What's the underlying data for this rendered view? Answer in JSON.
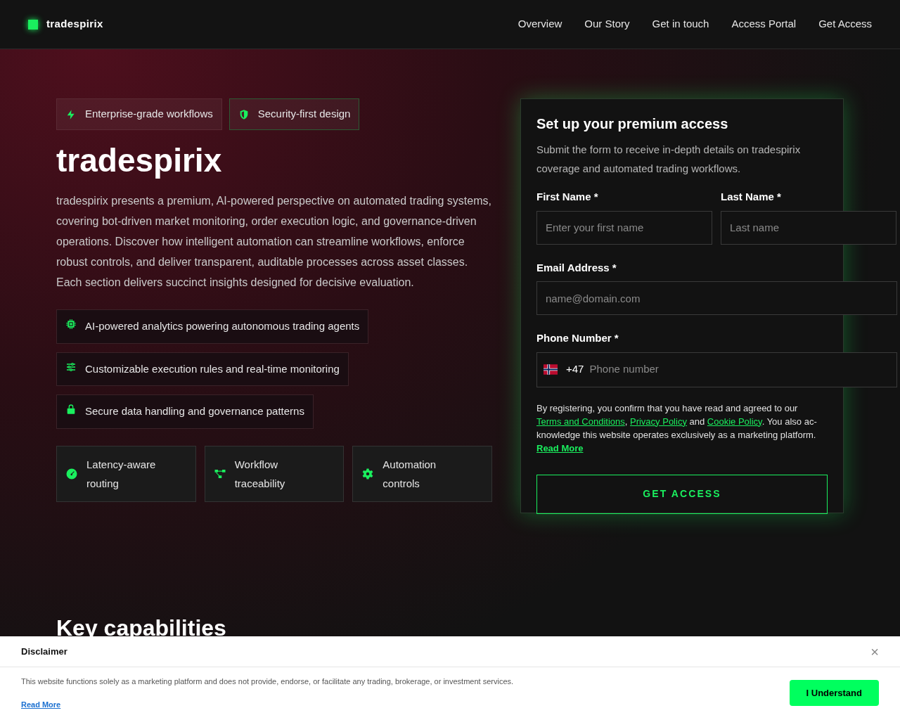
{
  "header": {
    "brand": "tradespirix",
    "nav": [
      {
        "label": "Overview"
      },
      {
        "label": "Our Story"
      },
      {
        "label": "Get in touch"
      },
      {
        "label": "Access Portal"
      },
      {
        "label": "Get Access"
      }
    ]
  },
  "hero": {
    "badges": [
      {
        "kind": "bolt",
        "label": "Enterprise-grade workflows"
      },
      {
        "kind": "shield",
        "label": "Security-first design"
      }
    ],
    "title": "tradespirix",
    "description": "tradespirix presents a premium, AI-powered perspective on automated trading systems, covering bot-driven market monitoring, order execution logic, and governance-driven operations. Discover how intelligent automation can streamline workflows, enforce robust controls, and deliver transparent, auditable processes across asset classes. Each section delivers succinct insights designed for decisive evaluation.",
    "features": [
      {
        "kind": "chip",
        "label": "AI-powered analytics powering autonomous trading agents"
      },
      {
        "kind": "sliders",
        "label": "Customizable execution rules and real-time monitoring"
      },
      {
        "kind": "lock",
        "label": "Secure data handling and governance patterns"
      }
    ],
    "tiles": [
      {
        "kind": "gauge",
        "label": "Latency-aware routing"
      },
      {
        "kind": "flow",
        "label": "Workflow traceability"
      },
      {
        "kind": "gear",
        "label": "Automation controls"
      }
    ]
  },
  "form": {
    "title": "Set up your premium access",
    "subtitle": "Submit the form to receive in-depth details on tradespirix coverage and automated trading workflows.",
    "first_name": {
      "label": "First Name *",
      "placeholder": "Enter your first name"
    },
    "last_name": {
      "label": "Last Name *",
      "placeholder": "Last name"
    },
    "email": {
      "label": "Email Address *",
      "placeholder": "name@domain.com"
    },
    "phone": {
      "label": "Phone Number *",
      "code": "+47",
      "placeholder": "Phone number"
    },
    "consent": {
      "intro": "By registering, you confirm that you have read and agreed to our",
      "terms": "Terms and Conditions",
      "comma": ",",
      "privacy": "Privacy Policy",
      "and": "and",
      "cookie": "Cookie Policy",
      "outro": ". You also ac-knowledge this website operates exclusively as a marketing platform.",
      "read_more": "Read More"
    },
    "submit": "GET ACCESS"
  },
  "section_heading": "Key capabilities",
  "disclaimer": {
    "title": "Disclaimer",
    "close": "×",
    "text": "This website functions solely as a marketing platform and does not provide, endorse, or facilitate any trading, brokerage, or investment services.",
    "read_more": "Read More",
    "button": "I Understand"
  }
}
